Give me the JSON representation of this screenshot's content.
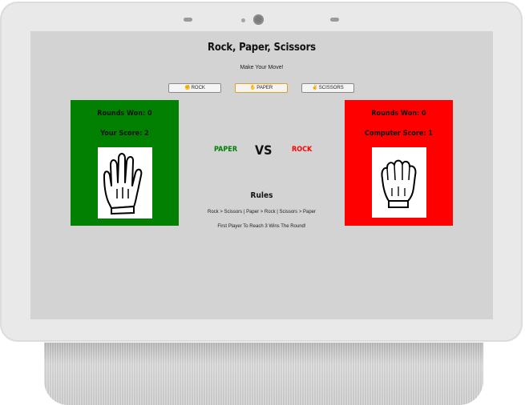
{
  "game": {
    "title": "Rock, Paper, Scissors",
    "prompt": "Make Your Move!"
  },
  "moves": [
    {
      "label": "ROCK",
      "icon": "rock-hand-icon",
      "selected": false
    },
    {
      "label": "PAPER",
      "icon": "paper-hand-icon",
      "selected": true
    },
    {
      "label": "SCISSORS",
      "icon": "scissors-hand-icon",
      "selected": false
    }
  ],
  "player": {
    "rounds_won": "Rounds Won: 0",
    "score": "Your Score: 2",
    "hand": "open-hand-icon",
    "color": "#018001"
  },
  "computer": {
    "rounds_won": "Rounds Won: 0",
    "score": "Computer Score: 1",
    "hand": "fist-hand-icon",
    "color": "#fe0000"
  },
  "matchup": {
    "player_choice": "PAPER",
    "vs": "VS",
    "computer_choice": "ROCK"
  },
  "rules": {
    "title": "Rules",
    "line1": "Rock > Scissors | Paper > Rock | Scissors > Paper",
    "line2": "First Player To Reach 3 Wins The Round!"
  }
}
